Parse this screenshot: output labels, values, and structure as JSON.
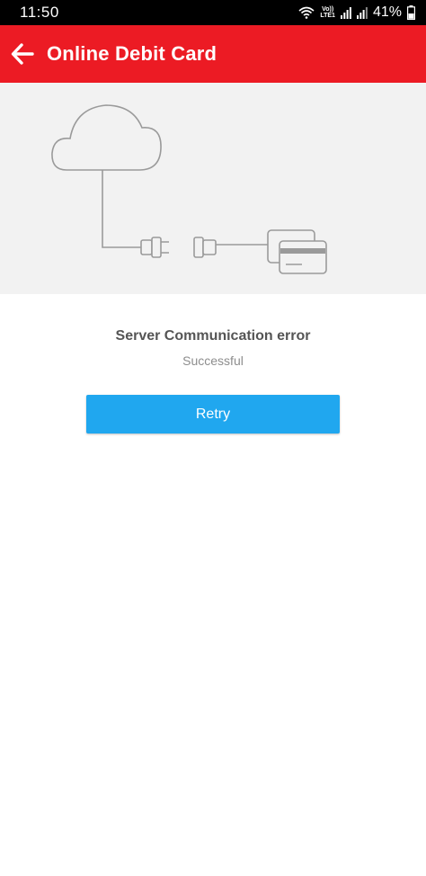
{
  "status_bar": {
    "time": "11:50",
    "volte_top": "Vo))",
    "volte_bottom": "LTE1",
    "battery_percent": "41%",
    "icons": [
      "wifi-icon",
      "signal-icon",
      "signal-icon",
      "battery-icon"
    ]
  },
  "app_bar": {
    "title": "Online Debit Card",
    "back_icon": "arrow-left-icon",
    "color": "#ec1b24"
  },
  "illustration": {
    "icons": [
      "cloud-icon",
      "plug-icon",
      "socket-icon",
      "credit-card-icon"
    ],
    "background": "#f2f2f2"
  },
  "message": {
    "title": "Server Communication error",
    "subtitle": "Successful"
  },
  "actions": {
    "retry_label": "Retry",
    "retry_color": "#20a7ef"
  }
}
